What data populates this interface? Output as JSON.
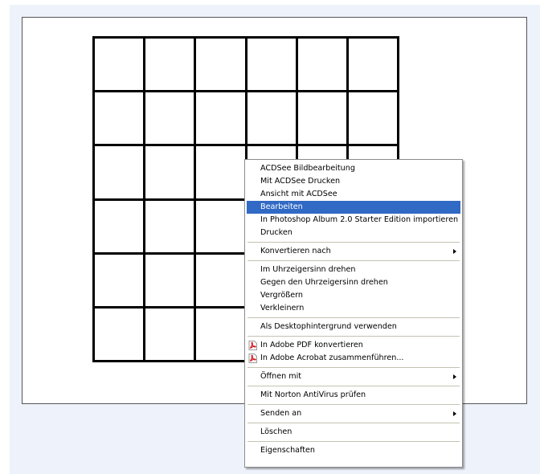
{
  "grid": {
    "rows": 6,
    "columns": 6
  },
  "context_menu": {
    "groups": [
      {
        "items": [
          {
            "label": "ACDSee Bildbearbeitung"
          },
          {
            "label": "Mit ACDSee Drucken"
          },
          {
            "label": "Ansicht mit ACDSee"
          },
          {
            "label": "Bearbeiten",
            "highlighted": true
          },
          {
            "label": "In Photoshop Album 2.0 Starter Edition importieren"
          },
          {
            "label": "Drucken"
          }
        ]
      },
      {
        "items": [
          {
            "label": "Konvertieren nach",
            "submenu": true
          }
        ]
      },
      {
        "items": [
          {
            "label": "Im Uhrzeigersinn drehen"
          },
          {
            "label": "Gegen den Uhrzeigersinn drehen"
          },
          {
            "label": "Vergrößern"
          },
          {
            "label": "Verkleinern"
          }
        ]
      },
      {
        "items": [
          {
            "label": "Als Desktophintergrund verwenden"
          }
        ]
      },
      {
        "items": [
          {
            "label": "In Adobe PDF konvertieren",
            "icon": "adobe-pdf-icon"
          },
          {
            "label": "In Adobe Acrobat zusammenführen...",
            "icon": "adobe-pdf-icon"
          }
        ]
      },
      {
        "items": [
          {
            "label": "Öffnen mit",
            "submenu": true
          }
        ]
      },
      {
        "items": [
          {
            "label": "Mit Norton AntiVirus prüfen"
          }
        ]
      },
      {
        "items": [
          {
            "label": "Senden an",
            "submenu": true
          }
        ]
      },
      {
        "items": [
          {
            "label": "Löschen"
          }
        ]
      },
      {
        "items": [
          {
            "label": "Eigenschaften"
          }
        ]
      }
    ]
  },
  "colors": {
    "highlight": "#316ac5",
    "viewer_background": "#eef2fb"
  }
}
